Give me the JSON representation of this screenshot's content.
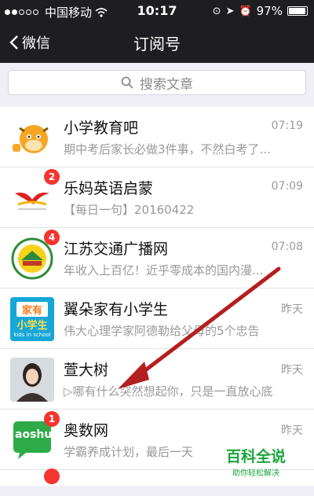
{
  "statusbar": {
    "carrier": "中国移动",
    "time": "10:17",
    "battery": "97%",
    "battery_level": 0.97
  },
  "navbar": {
    "back_label": "微信",
    "title": "订阅号"
  },
  "search": {
    "placeholder": "搜索文章"
  },
  "items": [
    {
      "name": "小学教育吧",
      "time": "07:19",
      "preview": "期中考后家长必做3件事，不然白考了...",
      "badge": ""
    },
    {
      "name": "乐妈英语启蒙",
      "time": "07:09",
      "preview": "【每日一句】20160422",
      "badge": "2"
    },
    {
      "name": "江苏交通广播网",
      "time": "07:08",
      "preview": "年收入上百亿！近乎零成本的国内漫...",
      "badge": "4"
    },
    {
      "name": "翼朵家有小学生",
      "time": "昨天",
      "preview": "伟大心理学家阿德勒给父母的5个忠告",
      "badge": ""
    },
    {
      "name": "萱大树",
      "time": "昨天",
      "preview": "▷哪有什么突然想起你，只是一直放心底",
      "badge": ""
    },
    {
      "name": "奥数网",
      "time": "昨天",
      "preview": "学霸养成计划，最后一天",
      "badge": "1"
    }
  ],
  "avatar_text": {
    "yiduo_line1": "家有",
    "yiduo_line2": "小学生",
    "yiduo_line3": "kids in school",
    "aoshu": "aoshu"
  },
  "watermark": {
    "title": "百科全说",
    "subtitle": "助你轻松解决"
  },
  "colors": {
    "bar": "#1e1e22",
    "badge": "#f43530",
    "arrow": "#b41f1f",
    "watermark": "#1ba53c"
  }
}
